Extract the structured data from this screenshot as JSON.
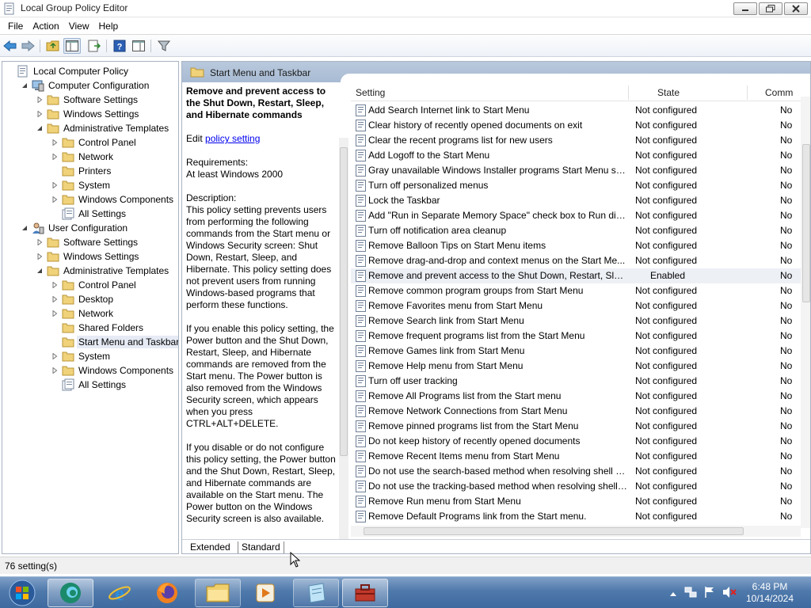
{
  "window": {
    "title": "Local Group Policy Editor"
  },
  "menu": [
    "File",
    "Action",
    "View",
    "Help"
  ],
  "tree": [
    {
      "label": "Local Computer Policy",
      "level": 0,
      "icon": "computer-policy-icon",
      "expander": "none"
    },
    {
      "label": "Computer Configuration",
      "level": 1,
      "icon": "computer-icon",
      "expander": "expanded"
    },
    {
      "label": "Software Settings",
      "level": 2,
      "icon": "folder-icon",
      "expander": "collapsed"
    },
    {
      "label": "Windows Settings",
      "level": 2,
      "icon": "folder-icon",
      "expander": "collapsed"
    },
    {
      "label": "Administrative Templates",
      "level": 2,
      "icon": "folder-icon",
      "expander": "expanded"
    },
    {
      "label": "Control Panel",
      "level": 3,
      "icon": "folder-icon",
      "expander": "collapsed"
    },
    {
      "label": "Network",
      "level": 3,
      "icon": "folder-icon",
      "expander": "collapsed"
    },
    {
      "label": "Printers",
      "level": 3,
      "icon": "folder-icon",
      "expander": "none"
    },
    {
      "label": "System",
      "level": 3,
      "icon": "folder-icon",
      "expander": "collapsed"
    },
    {
      "label": "Windows Components",
      "level": 3,
      "icon": "folder-icon",
      "expander": "collapsed"
    },
    {
      "label": "All Settings",
      "level": 3,
      "icon": "all-settings-icon",
      "expander": "none"
    },
    {
      "label": "User Configuration",
      "level": 1,
      "icon": "user-icon",
      "expander": "expanded"
    },
    {
      "label": "Software Settings",
      "level": 2,
      "icon": "folder-icon",
      "expander": "collapsed"
    },
    {
      "label": "Windows Settings",
      "level": 2,
      "icon": "folder-icon",
      "expander": "collapsed"
    },
    {
      "label": "Administrative Templates",
      "level": 2,
      "icon": "folder-icon",
      "expander": "expanded"
    },
    {
      "label": "Control Panel",
      "level": 3,
      "icon": "folder-icon",
      "expander": "collapsed"
    },
    {
      "label": "Desktop",
      "level": 3,
      "icon": "folder-icon",
      "expander": "collapsed"
    },
    {
      "label": "Network",
      "level": 3,
      "icon": "folder-icon",
      "expander": "collapsed"
    },
    {
      "label": "Shared Folders",
      "level": 3,
      "icon": "folder-icon",
      "expander": "none"
    },
    {
      "label": "Start Menu and Taskbar",
      "level": 3,
      "icon": "folder-icon",
      "expander": "none",
      "selected": true
    },
    {
      "label": "System",
      "level": 3,
      "icon": "folder-icon",
      "expander": "collapsed"
    },
    {
      "label": "Windows Components",
      "level": 3,
      "icon": "folder-icon",
      "expander": "collapsed"
    },
    {
      "label": "All Settings",
      "level": 3,
      "icon": "all-settings-icon",
      "expander": "none"
    }
  ],
  "pane": {
    "header": "Start Menu and Taskbar",
    "desc_title": "Remove and prevent access to the Shut Down, Restart, Sleep, and Hibernate commands",
    "edit_prefix": "Edit ",
    "edit_link": "policy setting ",
    "requirements_label": "Requirements:",
    "requirements_value": "At least Windows 2000",
    "description_label": "Description:",
    "description_p1": "This policy setting prevents users from performing the following commands from the Start menu or Windows Security screen: Shut Down, Restart, Sleep, and Hibernate. This policy setting does not prevent users from running Windows-based programs that perform these functions.",
    "description_p2": "If you enable this policy setting, the Power button and the Shut Down, Restart, Sleep, and Hibernate commands are removed from the Start menu. The Power button is also removed from the Windows Security screen, which appears when you press CTRL+ALT+DELETE.",
    "description_p3": "If you disable or do not configure this policy setting, the Power button and the Shut Down, Restart, Sleep, and Hibernate commands are available on the Start menu. The Power button on the Windows Security screen is also available."
  },
  "list": {
    "columns": {
      "setting": "Setting",
      "state": "State",
      "comment": "Comm"
    },
    "rows": [
      {
        "setting": "Add Search Internet link to Start Menu",
        "state": "Not configured",
        "comment": "No"
      },
      {
        "setting": "Clear history of recently opened documents on exit",
        "state": "Not configured",
        "comment": "No"
      },
      {
        "setting": "Clear the recent programs list for new users",
        "state": "Not configured",
        "comment": "No"
      },
      {
        "setting": "Add Logoff to the Start Menu",
        "state": "Not configured",
        "comment": "No"
      },
      {
        "setting": "Gray unavailable Windows Installer programs Start Menu sh...",
        "state": "Not configured",
        "comment": "No"
      },
      {
        "setting": "Turn off personalized menus",
        "state": "Not configured",
        "comment": "No"
      },
      {
        "setting": "Lock the Taskbar",
        "state": "Not configured",
        "comment": "No"
      },
      {
        "setting": "Add \"Run in Separate Memory Space\" check box to Run dial...",
        "state": "Not configured",
        "comment": "No"
      },
      {
        "setting": "Turn off notification area cleanup",
        "state": "Not configured",
        "comment": "No"
      },
      {
        "setting": "Remove Balloon Tips on Start Menu items",
        "state": "Not configured",
        "comment": "No"
      },
      {
        "setting": "Remove drag-and-drop and context menus on the Start Me...",
        "state": "Not configured",
        "comment": "No"
      },
      {
        "setting": "Remove and prevent access to the Shut Down, Restart, Sleep...",
        "state": "Enabled",
        "comment": "No",
        "highlight": true
      },
      {
        "setting": "Remove common program groups from Start Menu",
        "state": "Not configured",
        "comment": "No"
      },
      {
        "setting": "Remove Favorites menu from Start Menu",
        "state": "Not configured",
        "comment": "No"
      },
      {
        "setting": "Remove Search link from Start Menu",
        "state": "Not configured",
        "comment": "No"
      },
      {
        "setting": "Remove frequent programs list from the Start Menu",
        "state": "Not configured",
        "comment": "No"
      },
      {
        "setting": "Remove Games link from Start Menu",
        "state": "Not configured",
        "comment": "No"
      },
      {
        "setting": "Remove Help menu from Start Menu",
        "state": "Not configured",
        "comment": "No"
      },
      {
        "setting": "Turn off user tracking",
        "state": "Not configured",
        "comment": "No"
      },
      {
        "setting": "Remove All Programs list from the Start menu",
        "state": "Not configured",
        "comment": "No"
      },
      {
        "setting": "Remove Network Connections from Start Menu",
        "state": "Not configured",
        "comment": "No"
      },
      {
        "setting": "Remove pinned programs list from the Start Menu",
        "state": "Not configured",
        "comment": "No"
      },
      {
        "setting": "Do not keep history of recently opened documents",
        "state": "Not configured",
        "comment": "No"
      },
      {
        "setting": "Remove Recent Items menu from Start Menu",
        "state": "Not configured",
        "comment": "No"
      },
      {
        "setting": "Do not use the search-based method when resolving shell s...",
        "state": "Not configured",
        "comment": "No"
      },
      {
        "setting": "Do not use the tracking-based method when resolving shell ...",
        "state": "Not configured",
        "comment": "No"
      },
      {
        "setting": "Remove Run menu from Start Menu",
        "state": "Not configured",
        "comment": "No"
      },
      {
        "setting": "Remove Default Programs link from the Start menu.",
        "state": "Not configured",
        "comment": "No"
      }
    ]
  },
  "tabs": [
    "Extended",
    "Standard"
  ],
  "status": "76 setting(s)",
  "taskbar": {
    "apps": [
      "start-orb",
      "edge-app",
      "internet-explorer",
      "firefox",
      "file-explorer",
      "media-player",
      "notepad",
      "group-policy-editor"
    ],
    "time": "6:48 PM",
    "date": "10/14/2024"
  },
  "colors": {
    "pane_header": "#a8bbd3",
    "selection": "#e5eaf4",
    "link": "#0000ee",
    "taskbar": "#4f79ab"
  }
}
